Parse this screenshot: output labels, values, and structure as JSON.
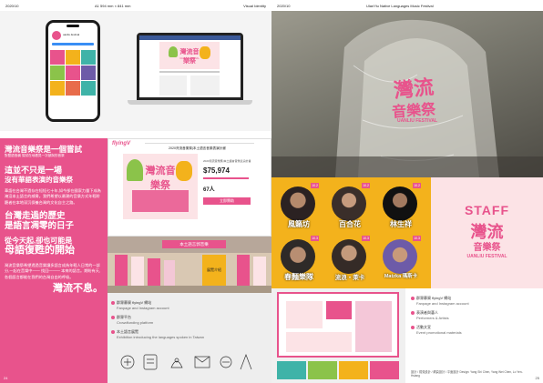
{
  "left_page": {
    "header": {
      "date": "2020/10",
      "dimension": "A1 594 mm × 841 mm",
      "section": "Visual Identity"
    },
    "folio": "24",
    "instagram": {
      "handle": "uanliu.festival",
      "grid_count": 9
    },
    "laptop": {
      "title": "灣流音樂祭",
      "subtitle": "UANLIU FESTIVAL"
    },
    "text_column": {
      "line1": "灣流音樂祭是一個嘗試",
      "line2": "對雙語島嶼 嘗試在地看見一次被與的音祭",
      "heading1_a": "這並不只是一場",
      "heading1_b": "沒有華語表演的音樂祭",
      "paragraph1": "華語在台灣不過存在短短七十年,如今卻在國家力量下成為淹沒本土語言的威脅。我們希望以最潮的音樂方式年輕聆聽者在本地深沉保養台灣的文化自主之路。",
      "heading2_a": "台灣走過的歷史",
      "heading2_b": "是語言凋零的日子",
      "heading3_a": "從今天起,卻也可能是",
      "heading3_b": "母語復甦的開始",
      "paragraph2": "灣流音樂祭希望透過音樂讓多語言成為年輕人日常的一部分,一起在音樂中—— 找回——— 本來的語言。期盼有天,各個語言都能在我們的台灣自由的呼吸。",
      "closing": "灣流不息。"
    },
    "crowdfund": {
      "logo": "flyingV",
      "title": "2020灣流音樂祭|本土語言音樂表演計畫",
      "amount": "$75,974",
      "backers": "67人",
      "button": "立即贊助"
    },
    "exhibition": {
      "banner": "本土語言郭音樂",
      "stand": "展覽介紹"
    },
    "captions": [
      {
        "zh": "群眾募資 flyingV 網站",
        "en": "Fanpage and Instagram account"
      },
      {
        "zh": "群眾平台",
        "en": "Crowdfunding platform"
      },
      {
        "zh": "本土語言展覽",
        "en": "Exhibition introducing the languages spoken in Taiwan"
      }
    ]
  },
  "right_page": {
    "header": {
      "date": "2020/10",
      "title": "UlanYiu Native Languages Music Festival"
    },
    "folio": "25",
    "raincoat_print": {
      "line1": "灣流",
      "line2": "音樂祭",
      "line3": "UANLIU FESTIVAL"
    },
    "artists": [
      {
        "name": "風籟坊",
        "date": "10.2"
      },
      {
        "name": "百合花",
        "date": "10.2"
      },
      {
        "name": "林生祥",
        "date": "10.2"
      },
      {
        "name": "春麵樂隊",
        "date": "10.3"
      },
      {
        "name": "流浪・萊卡",
        "date": "10.3"
      },
      {
        "name": "Matzka 瑪斯卡",
        "date": "10.3"
      }
    ],
    "staff": {
      "label": "STAFF",
      "brand": "灣流",
      "brand2": "音樂祭",
      "sub": "UANLIU FESTIVAL"
    },
    "captions": [
      {
        "zh": "群眾募資 flyingV 網站",
        "en": "Fanpage and Instagram account"
      },
      {
        "zh": "表演者與藝人",
        "en": "Performers & Artists"
      },
      {
        "zh": "活動文宣",
        "en": "Event promotional materials"
      }
    ],
    "credits": "設計 / 視覺設計 / 網頁設計 / 平面設計 Design: Yang Shi Chen, Yang Wei Chen, Lo Yen-Hsiang"
  },
  "colors": {
    "pink": "#e8538c",
    "yellow": "#f3b21c",
    "light_pink": "#fce3e6",
    "green": "#8bc34a",
    "teal": "#3fb3a8"
  }
}
